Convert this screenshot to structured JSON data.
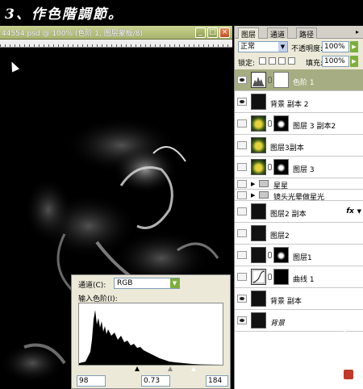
{
  "caption": "3、作色階調節。",
  "document": {
    "title": "44554.psd @ 100% (色阶 1, 图层蒙板/8)"
  },
  "window_buttons": {
    "min": "_",
    "max": "□",
    "close": "×"
  },
  "panel": {
    "tabs": [
      "图层",
      "通道",
      "路径"
    ],
    "menu_icon": "▸",
    "blend_mode": "正常",
    "opacity_label": "不透明度:",
    "opacity": "100%",
    "lock_label": "锁定:",
    "fill_label": "填充:",
    "fill": "100%",
    "layers": [
      {
        "name": "色阶 1",
        "visible": true,
        "selected": true,
        "kind": "adjust"
      },
      {
        "name": "背景 副本 2",
        "visible": true,
        "kind": "image"
      },
      {
        "name": "图层 3 副本2",
        "visible": false,
        "kind": "colored-mask"
      },
      {
        "name": "图层3副本",
        "visible": false,
        "kind": "colored"
      },
      {
        "name": "图层 3",
        "visible": false,
        "kind": "colored-mask"
      },
      {
        "name": "星星",
        "visible": false,
        "kind": "group"
      },
      {
        "name": "镜头光晕做星光",
        "visible": false,
        "kind": "group"
      },
      {
        "name": "图层2 副本",
        "visible": false,
        "kind": "fx",
        "fx": "fx"
      },
      {
        "name": "图层2",
        "visible": false,
        "kind": "image"
      },
      {
        "name": "图层1",
        "visible": false,
        "kind": "spot-mask"
      },
      {
        "name": "曲线 1",
        "visible": false,
        "kind": "curves"
      },
      {
        "name": "背景 副本",
        "visible": true,
        "kind": "image"
      },
      {
        "name": "背景",
        "visible": true,
        "kind": "image-italic"
      }
    ]
  },
  "levels": {
    "channel_label": "通道(C):",
    "channel": "RGB",
    "input_label": "输入色阶(I):",
    "black": "98",
    "gamma": "0.73",
    "white": "184"
  }
}
